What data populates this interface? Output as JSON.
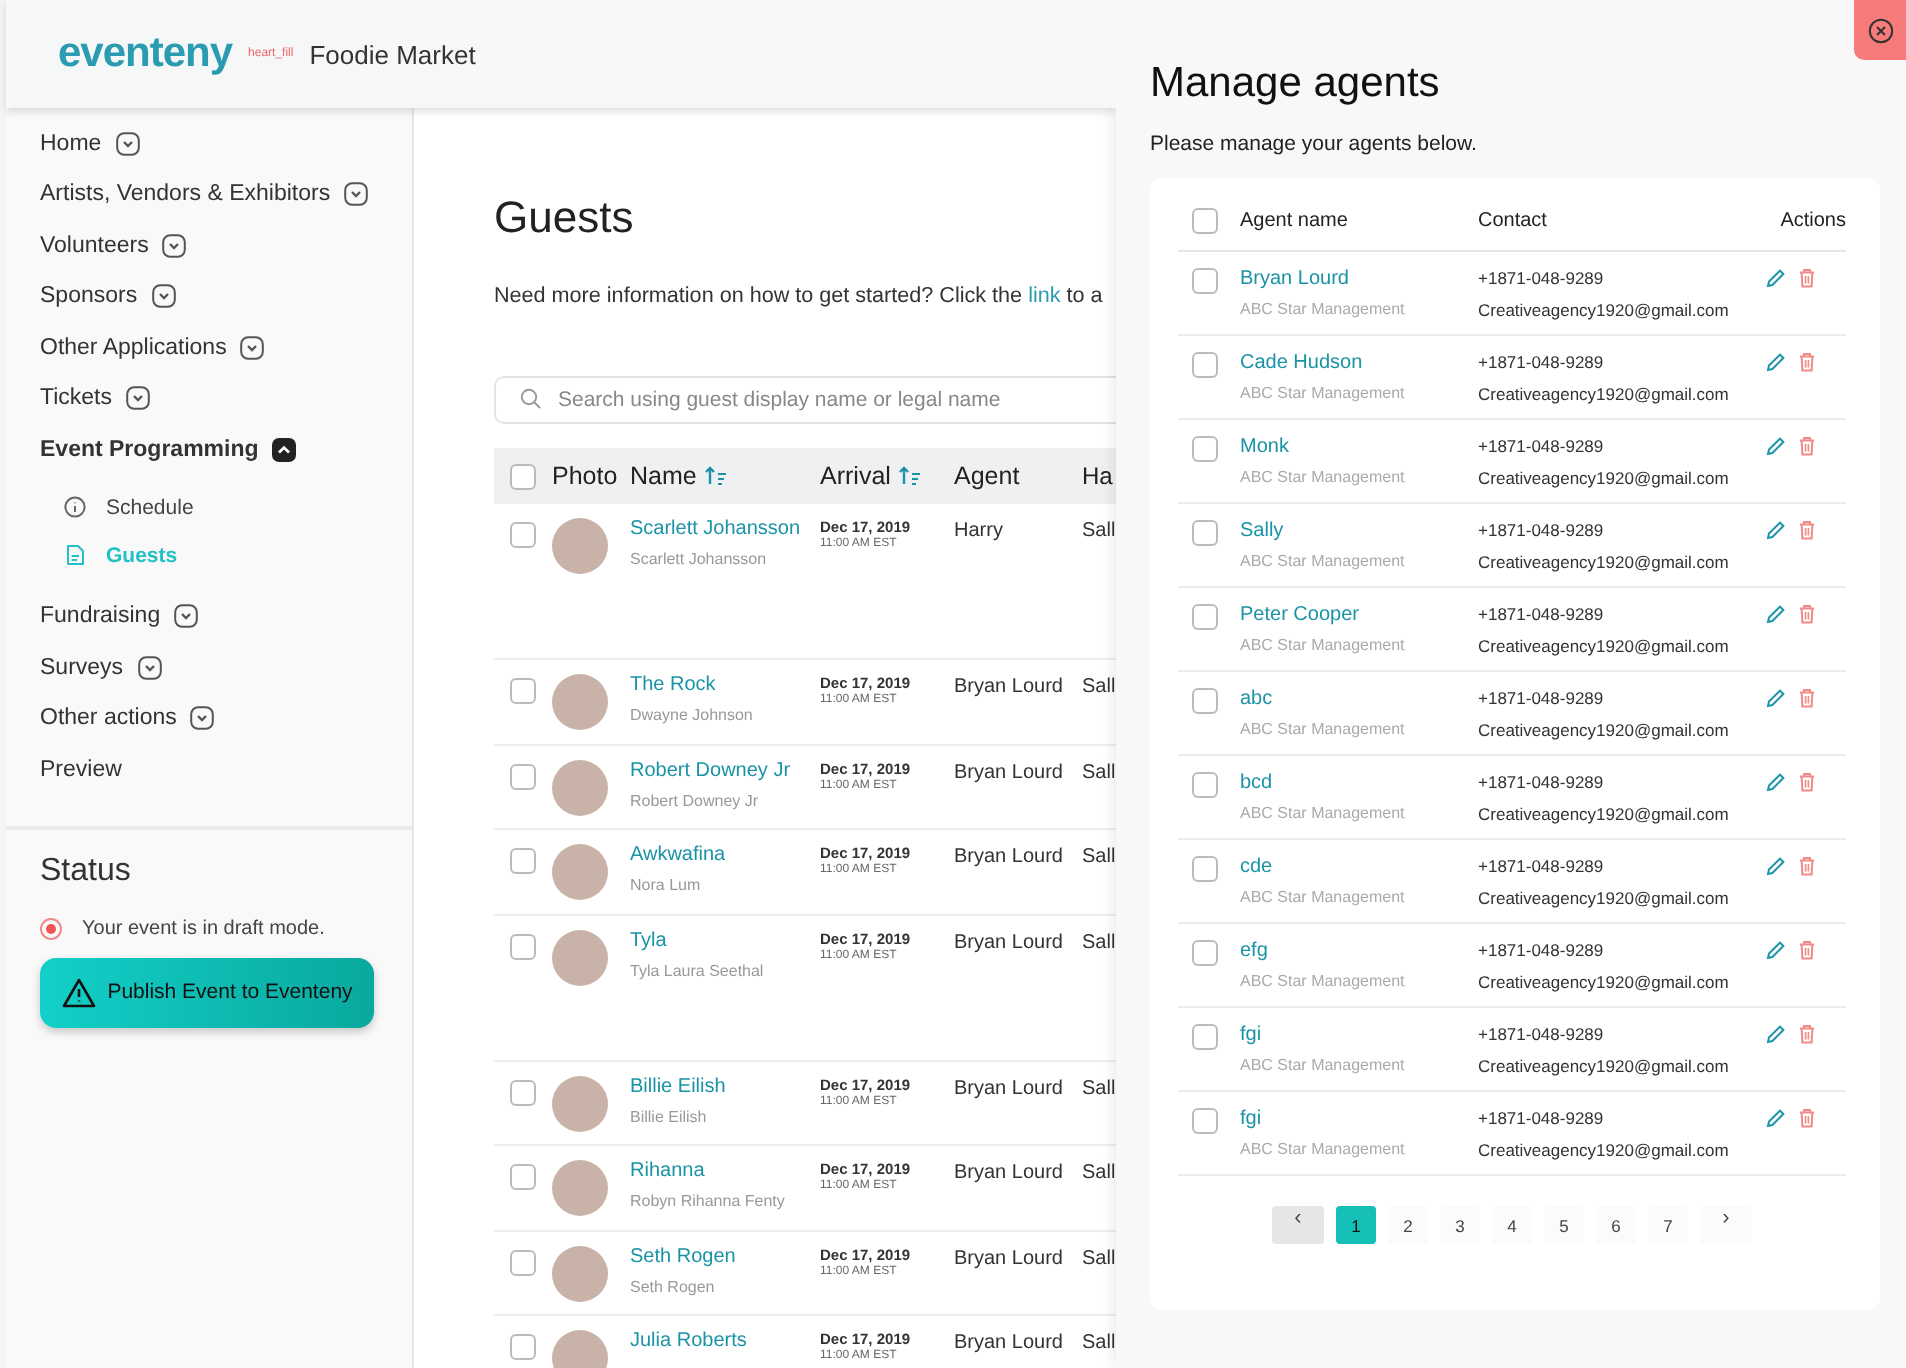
{
  "header": {
    "logo": "eventeny",
    "logo_note": "heart_fill",
    "event_name": "Foodie Market"
  },
  "sidebar": {
    "items": [
      {
        "label": "Home",
        "kind": "group",
        "expanded": false
      },
      {
        "label": "Artists, Vendors & Exhibitors",
        "kind": "group",
        "expanded": false
      },
      {
        "label": "Volunteers",
        "kind": "group",
        "expanded": false
      },
      {
        "label": "Sponsors",
        "kind": "group",
        "expanded": false
      },
      {
        "label": "Other Applications",
        "kind": "group",
        "expanded": false
      },
      {
        "label": "Tickets",
        "kind": "group",
        "expanded": false
      },
      {
        "label": "Event Programming",
        "kind": "group",
        "expanded": true,
        "children": [
          {
            "label": "Schedule",
            "kind": "info",
            "selected": false
          },
          {
            "label": "Guests",
            "kind": "page",
            "selected": true
          }
        ]
      },
      {
        "label": "Fundraising",
        "kind": "group",
        "expanded": false
      },
      {
        "label": "Surveys",
        "kind": "group",
        "expanded": false
      },
      {
        "label": "Other actions",
        "kind": "group",
        "expanded": false
      },
      {
        "label": "Preview",
        "kind": "link"
      }
    ],
    "status": {
      "title": "Status",
      "message": "Your event is in draft mode.",
      "publish_button": "Publish Event to Eventeny"
    }
  },
  "main": {
    "title": "Guests",
    "info": {
      "before": "Need more information on how to get started? Click the ",
      "link": "link",
      "after": " to a"
    },
    "search": {
      "placeholder": "Search using guest display name or legal name"
    },
    "table": {
      "select_all_checked": false,
      "columns": [
        "Photo",
        "Name",
        "Arrival",
        "Agent",
        "Ha"
      ],
      "rows": [
        {
          "name": "Scarlett Johansson",
          "legal_name": "Scarlett Johansson",
          "date": "Dec 17, 2019",
          "time": "11:00 AM EST",
          "agent": "Harry",
          "column_5": "Sall",
          "checked": false
        },
        {
          "name": "The Rock",
          "legal_name": "Dwayne Johnson",
          "date": "Dec 17, 2019",
          "time": "11:00 AM EST",
          "agent": "Bryan Lourd",
          "column_5": "Sall",
          "checked": false
        },
        {
          "name": "Robert Downey Jr",
          "legal_name": "Robert Downey Jr",
          "date": "Dec 17, 2019",
          "time": "11:00 AM EST",
          "agent": "Bryan Lourd",
          "column_5": "Sall",
          "checked": false
        },
        {
          "name": "Awkwafina",
          "legal_name": "Nora Lum",
          "date": "Dec 17, 2019",
          "time": "11:00 AM EST",
          "agent": "Bryan Lourd",
          "column_5": "Sall",
          "checked": false
        },
        {
          "name": "Tyla",
          "legal_name": "Tyla Laura Seethal",
          "date": "Dec 17, 2019",
          "time": "11:00 AM EST",
          "agent": "Bryan Lourd",
          "column_5": "Sall",
          "checked": false
        },
        {
          "name": "Billie Eilish",
          "legal_name": "Billie Eilish",
          "date": "Dec 17, 2019",
          "time": "11:00 AM EST",
          "agent": "Bryan Lourd",
          "column_5": "Sall",
          "checked": false
        },
        {
          "name": "Rihanna",
          "legal_name": "Robyn Rihanna Fenty",
          "date": "Dec 17, 2019",
          "time": "11:00 AM EST",
          "agent": "Bryan Lourd",
          "column_5": "Sall",
          "checked": false
        },
        {
          "name": "Seth Rogen",
          "legal_name": "Seth Rogen",
          "date": "Dec 17, 2019",
          "time": "11:00 AM EST",
          "agent": "Bryan Lourd",
          "column_5": "Sall",
          "checked": false
        },
        {
          "name": "Julia Roberts",
          "date": "Dec 17, 2019",
          "time": "11:00 AM EST",
          "agent": "Bryan Lourd",
          "column_5": "Sall",
          "checked": false
        }
      ]
    }
  },
  "agents_panel": {
    "title": "Manage agents",
    "subtitle": "Please manage your agents below.",
    "select_all_checked": false,
    "columns": [
      "Agent name",
      "Contact",
      "Actions"
    ],
    "rows": [
      {
        "name": "Bryan Lourd",
        "agency": "ABC Star Management",
        "phone": "+1871-048-9289",
        "email": "Creativeagency1920@gmail.com",
        "checked": false
      },
      {
        "name": "Cade Hudson",
        "agency": "ABC Star Management",
        "phone": "+1871-048-9289",
        "email": "Creativeagency1920@gmail.com",
        "checked": false
      },
      {
        "name": "Monk",
        "agency": "ABC Star Management",
        "phone": "+1871-048-9289",
        "email": "Creativeagency1920@gmail.com",
        "checked": false
      },
      {
        "name": "Sally",
        "agency": "ABC Star Management",
        "phone": "+1871-048-9289",
        "email": "Creativeagency1920@gmail.com",
        "checked": false
      },
      {
        "name": "Peter Cooper",
        "agency": "ABC Star Management",
        "phone": "+1871-048-9289",
        "email": "Creativeagency1920@gmail.com",
        "checked": false
      },
      {
        "name": "abc",
        "agency": "ABC Star Management",
        "phone": "+1871-048-9289",
        "email": "Creativeagency1920@gmail.com",
        "checked": false
      },
      {
        "name": "bcd",
        "agency": "ABC Star Management",
        "phone": "+1871-048-9289",
        "email": "Creativeagency1920@gmail.com",
        "checked": false
      },
      {
        "name": "cde",
        "agency": "ABC Star Management",
        "phone": "+1871-048-9289",
        "email": "Creativeagency1920@gmail.com",
        "checked": false
      },
      {
        "name": "efg",
        "agency": "ABC Star Management",
        "phone": "+1871-048-9289",
        "email": "Creativeagency1920@gmail.com",
        "checked": false
      },
      {
        "name": "fgi",
        "agency": "ABC Star Management",
        "phone": "+1871-048-9289",
        "email": "Creativeagency1920@gmail.com",
        "checked": false
      },
      {
        "name": "fgi",
        "agency": "ABC Star Management",
        "phone": "+1871-048-9289",
        "email": "Creativeagency1920@gmail.com",
        "checked": false
      }
    ],
    "pagination": {
      "previous": "‹",
      "next": "›",
      "previous_disabled": true,
      "pages": [
        {
          "label": "1",
          "selected": true
        },
        {
          "label": "2",
          "selected": false
        },
        {
          "label": "3",
          "selected": false
        },
        {
          "label": "4",
          "selected": false
        },
        {
          "label": "5",
          "selected": false
        },
        {
          "label": "6",
          "selected": false
        },
        {
          "label": "7",
          "selected": false
        }
      ]
    }
  }
}
